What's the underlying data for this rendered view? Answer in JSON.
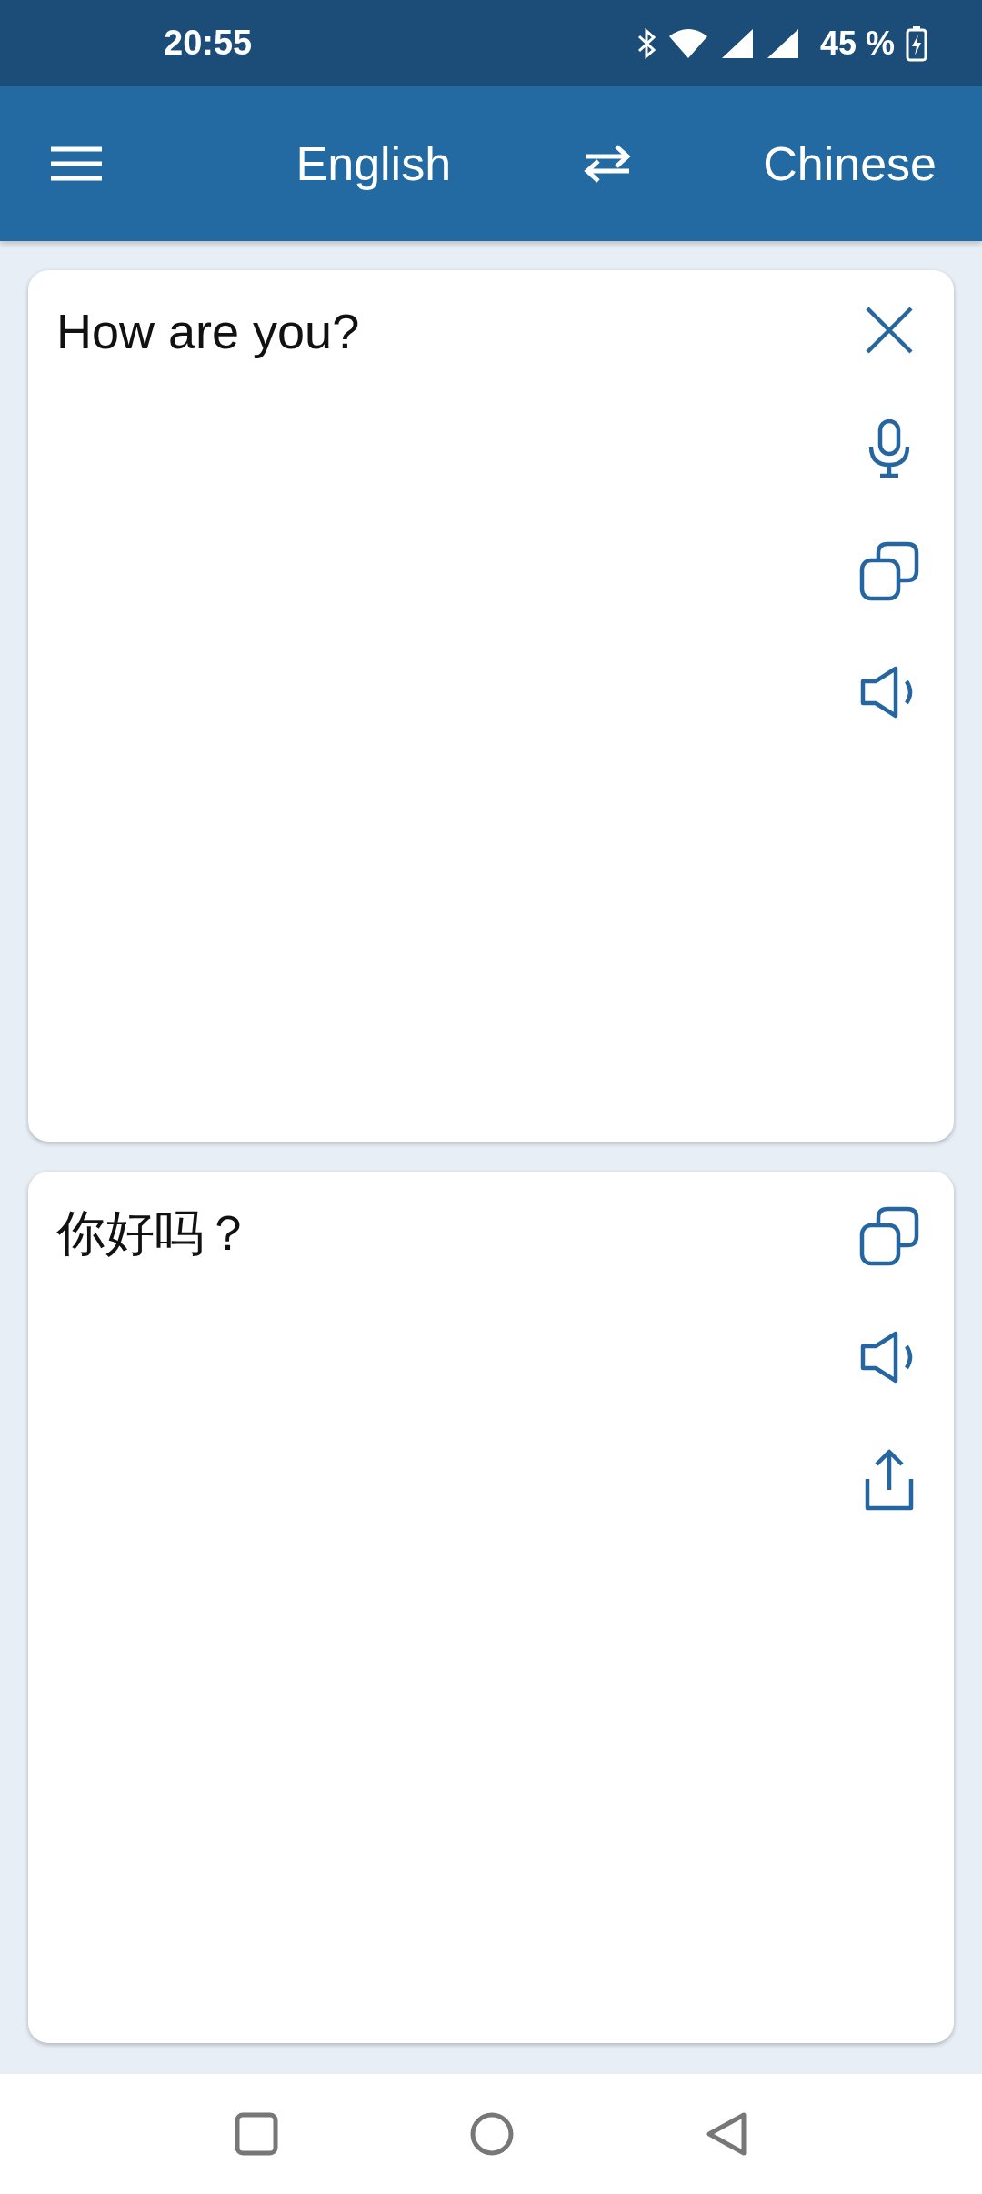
{
  "status_bar": {
    "time": "20:55",
    "battery": "45 %"
  },
  "header": {
    "source_language": "English",
    "target_language": "Chinese"
  },
  "source_card": {
    "text": "How are you?"
  },
  "result_card": {
    "text": "你好吗？"
  }
}
